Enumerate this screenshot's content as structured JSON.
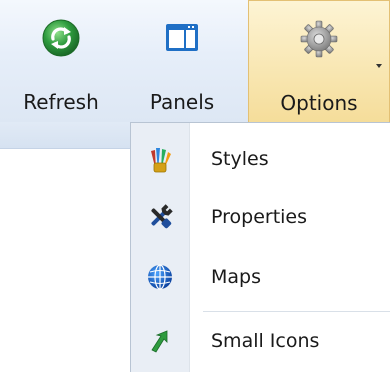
{
  "ribbon": {
    "refresh": {
      "label": "Refresh",
      "icon": "refresh-icon"
    },
    "panels": {
      "label": "Panels",
      "icon": "panels-icon"
    },
    "options": {
      "label": "Options",
      "icon": "gear-icon",
      "dropdown_icon": "chevron-down-icon"
    }
  },
  "menu": {
    "items": [
      {
        "label": "Styles",
        "icon": "brushes-icon"
      },
      {
        "label": "Properties",
        "icon": "tools-icon"
      },
      {
        "label": "Maps",
        "icon": "globe-icon"
      },
      {
        "label": "Small Icons",
        "icon": "small-icons-icon"
      }
    ]
  },
  "colors": {
    "ribbon_bg": "#e6eef9",
    "options_active_bg": "#f5dd9a",
    "menu_gutter": "#e9eef5",
    "refresh_green": "#2e9b3e",
    "panels_blue": "#1f6fc5"
  }
}
